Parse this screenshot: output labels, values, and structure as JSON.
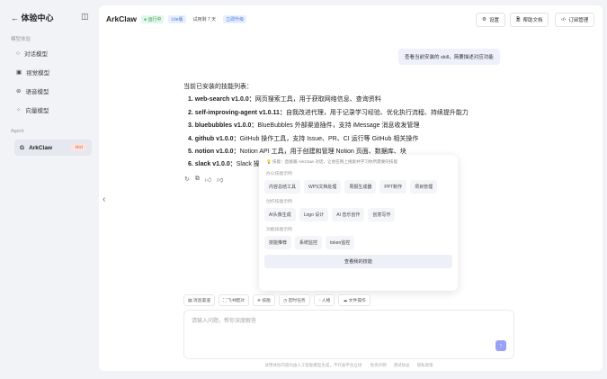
{
  "sidebar": {
    "title": "体验中心",
    "group1": "模型体验",
    "items": [
      {
        "label": "对话模型",
        "icon": "chat-icon"
      },
      {
        "label": "视觉模型",
        "icon": "image-icon"
      },
      {
        "label": "语音模型",
        "icon": "voice-icon"
      },
      {
        "label": "向量模型",
        "icon": "vector-icon"
      }
    ],
    "group2": "Agent",
    "agent": {
      "label": "ArkClaw",
      "badge": "Hot"
    }
  },
  "header": {
    "app": "ArkClaw",
    "status": "运行中",
    "plan": "Lite版",
    "trial": "试用剩 7 天",
    "upgrade": "立即升级",
    "settings": "设置",
    "docs": "帮助文档",
    "subscription": "订阅管理"
  },
  "chat": {
    "user_message": "查看当前安装的 skill，简要描述对应功能",
    "reply_title": "当前已安装的技能列表：",
    "skills": [
      {
        "name": "1. web-search v1.0.0：",
        "desc": "网页搜索工具，用于获取网络信息、查询资料"
      },
      {
        "name": "2. self-improving-agent v1.0.11：",
        "desc": "自我改进代理，用于记录学习经验、优化执行流程、持续提升能力"
      },
      {
        "name": "3. bluebubbles v1.0.0：",
        "desc": "BlueBubbles 外部渠道插件，支持 iMessage 消息收发管理"
      },
      {
        "name": "4. github v1.0.0：",
        "desc": "GitHub 操作工具，支持 Issue、PR、CI 运行等 GitHub 相关操作"
      },
      {
        "name": "5. notion v1.0.0：",
        "desc": "Notion API 工具，用于创建和管理 Notion 页面、数据库、块"
      },
      {
        "name": "6. slack v1.0.0：",
        "desc": "Slack 操作工具"
      }
    ]
  },
  "popup": {
    "tip": "技能：直接跟 ArkClaw 对话，让他在网上搜索并学习你所需要的技能",
    "groups": [
      {
        "title": "办公技能示例",
        "chips": [
          "内容总结工具",
          "WPS文档处理",
          "周报生成器",
          "PPT制作",
          "项目管理"
        ]
      },
      {
        "title": "创作技能示例",
        "chips": [
          "AI头像生成",
          "Logo 设计",
          "AI 音乐创作",
          "创意写作"
        ]
      },
      {
        "title": "功能技能示例",
        "chips": [
          "技能推荐",
          "系统监控",
          "token监控"
        ]
      }
    ],
    "view_all": "查看我的技能"
  },
  "tools": [
    "消息渠道",
    "飞书配对",
    "技能",
    "定时任务",
    "人格",
    "文件操作"
  ],
  "input": {
    "placeholder": "请输入问题，帮你深度解答"
  },
  "footer": {
    "disclaimer": "试用体验内容均由人工智能模型生成，不代表平台立场",
    "links": [
      "免责声明",
      "测试协议",
      "隐私政策"
    ]
  }
}
